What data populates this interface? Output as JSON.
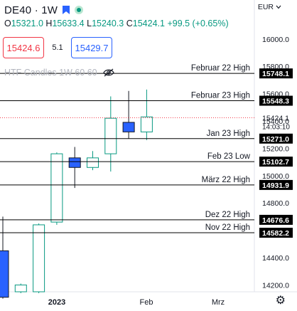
{
  "header": {
    "symbol": "DE40 · 1W",
    "flag_icon": "flag-icon",
    "status_icon": "market-open-dot-icon"
  },
  "ohlc": {
    "o_label": "O",
    "o_value": "15321.0",
    "h_label": "H",
    "h_value": "15633.4",
    "l_label": "L",
    "l_value": "15240.3",
    "c_label": "C",
    "c_value": "15424.1",
    "change": "+99.5 (+0.65%)"
  },
  "trade": {
    "sell_price": "15424.6",
    "spread": "5.1",
    "buy_price": "15429.7"
  },
  "indicator": {
    "label": "HTF Candles 1W 60 60",
    "icon": "eye-hidden-icon"
  },
  "currency": {
    "label": "EUR",
    "icon": "chevron-down-icon"
  },
  "settings_icon": "gear-icon",
  "colors": {
    "up": "#ffffff",
    "up_border": "#089981",
    "down": "#2962ff",
    "levels": "#000000",
    "price_line": "#f23645",
    "text": "#131722"
  },
  "chart_data": {
    "type": "candlestick",
    "ylim": [
      14150,
      16150
    ],
    "y_ticks": [
      16000,
      15800,
      15600,
      15400,
      15200,
      15000,
      14800,
      14600,
      14400,
      14200
    ],
    "x_ticks": [
      {
        "label": "2023",
        "bold": true
      },
      {
        "label": "Feb",
        "bold": false
      },
      {
        "label": "Mrz",
        "bold": false
      }
    ],
    "candles": [
      {
        "dir": "down",
        "o": 14450,
        "c": 14110,
        "h": 14700,
        "l": 14100
      },
      {
        "dir": "up",
        "o": 14150,
        "c": 14200,
        "h": 14210,
        "l": 14140
      },
      {
        "dir": "up",
        "o": 14150,
        "c": 14640,
        "h": 14650,
        "l": 14140
      },
      {
        "dir": "up",
        "o": 14660,
        "c": 15160,
        "h": 15170,
        "l": 14640
      },
      {
        "dir": "down",
        "o": 15130,
        "c": 15060,
        "h": 15210,
        "l": 14910
      },
      {
        "dir": "up",
        "o": 15060,
        "c": 15130,
        "h": 15180,
        "l": 15040
      },
      {
        "dir": "up",
        "o": 15160,
        "c": 15420,
        "h": 15580,
        "l": 15030
      },
      {
        "dir": "down",
        "o": 15390,
        "c": 15320,
        "h": 15620,
        "l": 15270
      },
      {
        "dir": "up",
        "o": 15320,
        "c": 15430,
        "h": 15630,
        "l": 15260
      }
    ],
    "levels": [
      {
        "label": "Februar 22 High",
        "value": 15748.1,
        "price_label": "15748.1"
      },
      {
        "label": "Februar 23 High",
        "value": 15548.3,
        "price_label": "15548.3"
      },
      {
        "label": "Jan 23 High",
        "value": 15271.0,
        "price_label": "15271.0"
      },
      {
        "label": "Feb 23 Low",
        "value": 15102.7,
        "price_label": "15102.7"
      },
      {
        "label": "März 22 High",
        "value": 14931.9,
        "price_label": "14931.9"
      },
      {
        "label": "Dez 22 High",
        "value": 14676.6,
        "price_label": "14676.6"
      },
      {
        "label": "Nov 22 High",
        "value": 14582.2,
        "price_label": "14582.2"
      }
    ],
    "current_price": {
      "value": 15424.1,
      "label": "15424.1",
      "countdown": "14:03:10"
    }
  }
}
